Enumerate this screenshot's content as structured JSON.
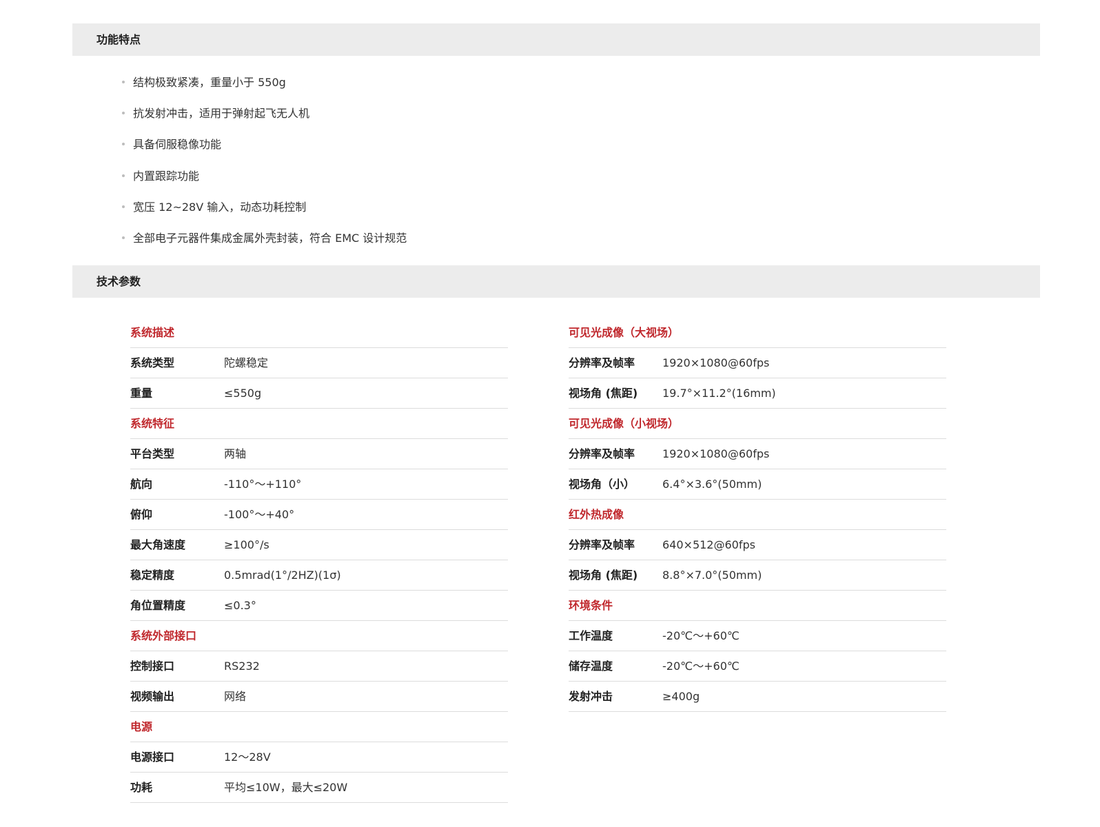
{
  "features": {
    "title": "功能特点",
    "items": [
      "结构极致紧凑，重量小于 550g",
      "抗发射冲击，适用于弹射起飞无人机",
      "具备伺服稳像功能",
      "内置跟踪功能",
      "宽压 12~28V 输入，动态功耗控制",
      "全部电子元器件集成金属外壳封装，符合 EMC 设计规范"
    ]
  },
  "specs": {
    "title": "技术参数",
    "accent_color": "#c0282d",
    "left": [
      {
        "type": "group",
        "label": "系统描述"
      },
      {
        "type": "item",
        "label": "系统类型",
        "value": "陀螺稳定"
      },
      {
        "type": "item",
        "label": "重量",
        "value": "≤550g"
      },
      {
        "type": "group",
        "label": "系统特征"
      },
      {
        "type": "item",
        "label": "平台类型",
        "value": "两轴"
      },
      {
        "type": "item",
        "label": "航向",
        "value": "-110°～+110°"
      },
      {
        "type": "item",
        "label": "俯仰",
        "value": "-100°～+40°"
      },
      {
        "type": "item",
        "label": "最大角速度",
        "value": "≥100°/s"
      },
      {
        "type": "item",
        "label": "稳定精度",
        "value": "0.5mrad(1°/2HZ)(1σ)"
      },
      {
        "type": "item",
        "label": "角位置精度",
        "value": "≤0.3°"
      },
      {
        "type": "group",
        "label": "系统外部接口"
      },
      {
        "type": "item",
        "label": "控制接口",
        "value": "RS232"
      },
      {
        "type": "item",
        "label": "视频输出",
        "value": "网络"
      },
      {
        "type": "group",
        "label": "电源"
      },
      {
        "type": "item",
        "label": "电源接口",
        "value": "12～28V"
      },
      {
        "type": "item",
        "label": "功耗",
        "value": "平均≤10W，最大≤20W"
      }
    ],
    "right": [
      {
        "type": "group",
        "label": "可见光成像（大视场）"
      },
      {
        "type": "item",
        "label": "分辨率及帧率",
        "value": "1920×1080@60fps"
      },
      {
        "type": "item",
        "label": "视场角 (焦距)",
        "value": "19.7°×11.2°(16mm)"
      },
      {
        "type": "group",
        "label": "可见光成像（小视场）"
      },
      {
        "type": "item",
        "label": "分辨率及帧率",
        "value": "1920×1080@60fps"
      },
      {
        "type": "item",
        "label": "视场角（小）",
        "value": "6.4°×3.6°(50mm)"
      },
      {
        "type": "group",
        "label": "红外热成像"
      },
      {
        "type": "item",
        "label": "分辨率及帧率",
        "value": "640×512@60fps"
      },
      {
        "type": "item",
        "label": "视场角 (焦距)",
        "value": "8.8°×7.0°(50mm)"
      },
      {
        "type": "group",
        "label": "环境条件"
      },
      {
        "type": "item",
        "label": "工作温度",
        "value": "-20℃～+60℃"
      },
      {
        "type": "item",
        "label": "储存温度",
        "value": "-20℃～+60℃"
      },
      {
        "type": "item",
        "label": "发射冲击",
        "value": "≥400g"
      }
    ]
  }
}
